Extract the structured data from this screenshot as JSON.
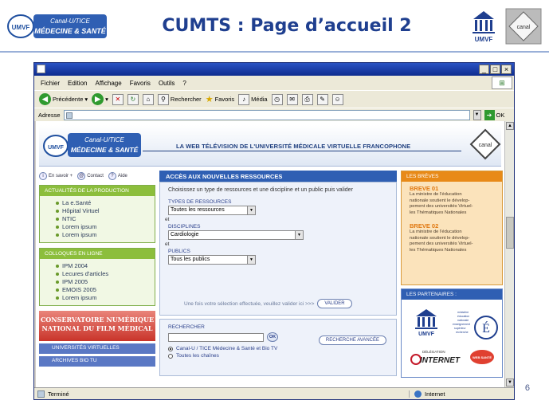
{
  "slide": {
    "title": "CUMTS : Page d’accueil 2",
    "number": "6",
    "logo_left": {
      "line1": "Canal-U/TICE",
      "line2": "MÉDECINE & SANTÉ",
      "badge": "UMVF"
    },
    "logo_umvf": "UMVF",
    "logo_canal": "canal"
  },
  "browser": {
    "menu": [
      "Fichier",
      "Edition",
      "Affichage",
      "Favoris",
      "Outils",
      "?"
    ],
    "toolbar": {
      "back": "Précédente",
      "search": "Rechercher",
      "favorites": "Favoris",
      "media": "Média"
    },
    "address_label": "Adresse",
    "address_value": "",
    "go_label": "OK",
    "status_left": "Terminé",
    "status_zone": "Internet",
    "window_buttons": [
      "_",
      "□",
      "×"
    ]
  },
  "site": {
    "logo": {
      "line1": "Canal-U/TICE",
      "line2": "MÉDECINE & SANTÉ",
      "badge": "UMVF"
    },
    "tagline": "LA WEB TÉLÉVISION  DE L'UNIVERSITÉ MÉDICALE VIRTUELLE FRANCOPHONE",
    "canal_logo": "canal",
    "quicklinks": [
      "En savoir +",
      "Contact",
      "Aide"
    ],
    "production": {
      "header": "ACTUALITÉS DE LA PRODUCTION",
      "items": [
        "La e.Santé",
        "Hôpital Virtuel",
        "NTIC",
        "Lorem ipsum",
        "Lorem ipsum"
      ]
    },
    "colloques": {
      "header": "COLLOQUES EN LIGNE",
      "items": [
        "IPM 2004",
        "Lecures d'articles",
        "IPM 2005",
        "EMOIS 2005",
        "Lorem ipsum"
      ]
    },
    "conservatoire": [
      "CONSERVATOIRE NUMÉRIQUE",
      "NATIONAL DU FILM MÉDICAL"
    ],
    "strips": [
      "UNIVERSITÉS VIRTUELLES",
      "ARCHIVES BIO TU"
    ],
    "resources": {
      "header": "ACCÈS AUX NOUVELLES RESSOURCES",
      "intro": "Choisissez un type de ressources et une discipline et un public puis valider",
      "types_label": "TYPES DE RESSOURCES",
      "types_value": "Toutes les ressources",
      "et": "et",
      "disciplines_label": "DISCIPLINES",
      "disciplines_value": "Cardiologie",
      "publics_label": "PUBLICS",
      "publics_value": "Tous les publics",
      "validate_prompt": "Une fois votre sélection effectuée, veuillez valider ici >>>",
      "validate_button": "VALIDER"
    },
    "search": {
      "label": "RECHERCHER",
      "ok": "OK",
      "advanced": "RECHERCHE AVANCÉE",
      "radio1": "Canal-U / TICE Médecine & Santé et Bio TV",
      "radio2": "Toutes les chaînes"
    },
    "news": {
      "header": "LES BRÈVES",
      "items": [
        {
          "title": "BREVE 01",
          "text": [
            "La ministre de l'éducation",
            "nationale soutient le dévelop-",
            "pement des universités Virtuel-",
            "les Thématiques Nationales"
          ]
        },
        {
          "title": "BREVE 02",
          "text": [
            "La ministre de l'éducation",
            "nationale soutient le dévelop-",
            "pement des universités Virtuel-",
            "les Thématiques Nationales"
          ]
        }
      ]
    },
    "partners": {
      "header": "LES PARTENAIRES :",
      "logos": [
        "UMVF",
        "ministère éducation nationale enseignement supérieur recherche",
        "DÉLÉGATION",
        "INTERNET",
        "WEB SANTÉ"
      ]
    }
  },
  "colors": {
    "title_blue": "#1f3f8f",
    "green": "#8cbe3c",
    "blue": "#2f5fb3",
    "orange": "#e88a18"
  }
}
